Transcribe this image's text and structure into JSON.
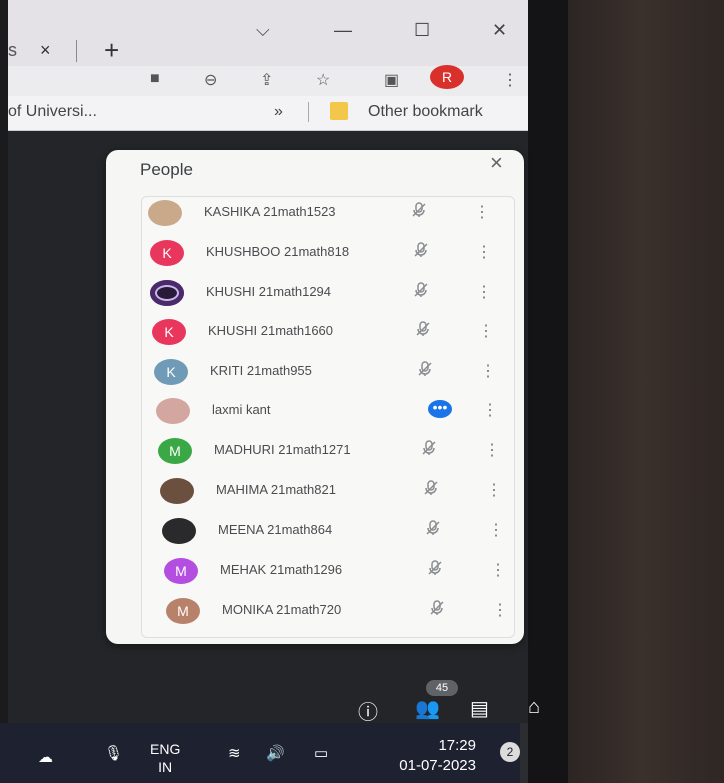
{
  "browser": {
    "tab_stub": "s",
    "tab_close": "×",
    "new_tab": "+",
    "window_controls": [
      "⌵",
      "—",
      "☐",
      "✕"
    ],
    "toolbar_icons": [
      "camera-icon",
      "zoom-out-icon",
      "share-icon",
      "star-icon",
      "sidebar-icon"
    ],
    "profile_initial": "R",
    "profile_color": "#d9302c",
    "bookmark_left": "of Universi...",
    "bookmark_chevron": "»",
    "bookmark_other": "Other bookmark"
  },
  "people_panel": {
    "title": "People",
    "close": "×",
    "participants": [
      {
        "name": "KASHIKA 21math1523",
        "avatar": "photo",
        "color": "#c9a98a",
        "status": "muted"
      },
      {
        "name": "KHUSHBOO 21math818",
        "avatar": "K",
        "color": "#e8365d",
        "status": "muted"
      },
      {
        "name": "KHUSHI 21math1294",
        "avatar": "ring",
        "color": "#4a2a6a",
        "status": "muted"
      },
      {
        "name": "KHUSHI 21math1660",
        "avatar": "K",
        "color": "#e8365d",
        "status": "muted"
      },
      {
        "name": "KRITI 21math955",
        "avatar": "K",
        "color": "#6f9bb7",
        "status": "muted"
      },
      {
        "name": "laxmi kant",
        "avatar": "photo",
        "color": "#d4a6a0",
        "status": "speaking"
      },
      {
        "name": "MADHURI 21math1271",
        "avatar": "M",
        "color": "#3aa845",
        "status": "muted"
      },
      {
        "name": "MAHIMA 21math821",
        "avatar": "photo",
        "color": "#6b5040",
        "status": "muted"
      },
      {
        "name": "MEENA 21math864",
        "avatar": "dark",
        "color": "#2a2a2c",
        "status": "muted"
      },
      {
        "name": "MEHAK 21math1296",
        "avatar": "M",
        "color": "#b44ee0",
        "status": "muted"
      },
      {
        "name": "MONIKA 21math720",
        "avatar": "M",
        "color": "#b8826a",
        "status": "muted"
      }
    ]
  },
  "meet_controls": {
    "participant_count": "45",
    "icons": [
      "info-icon",
      "people-icon",
      "chat-icon",
      "activities-icon"
    ]
  },
  "taskbar": {
    "lang_line1": "ENG",
    "lang_line2": "IN",
    "time": "17:29",
    "date": "01-07-2023",
    "notification_count": "2"
  }
}
